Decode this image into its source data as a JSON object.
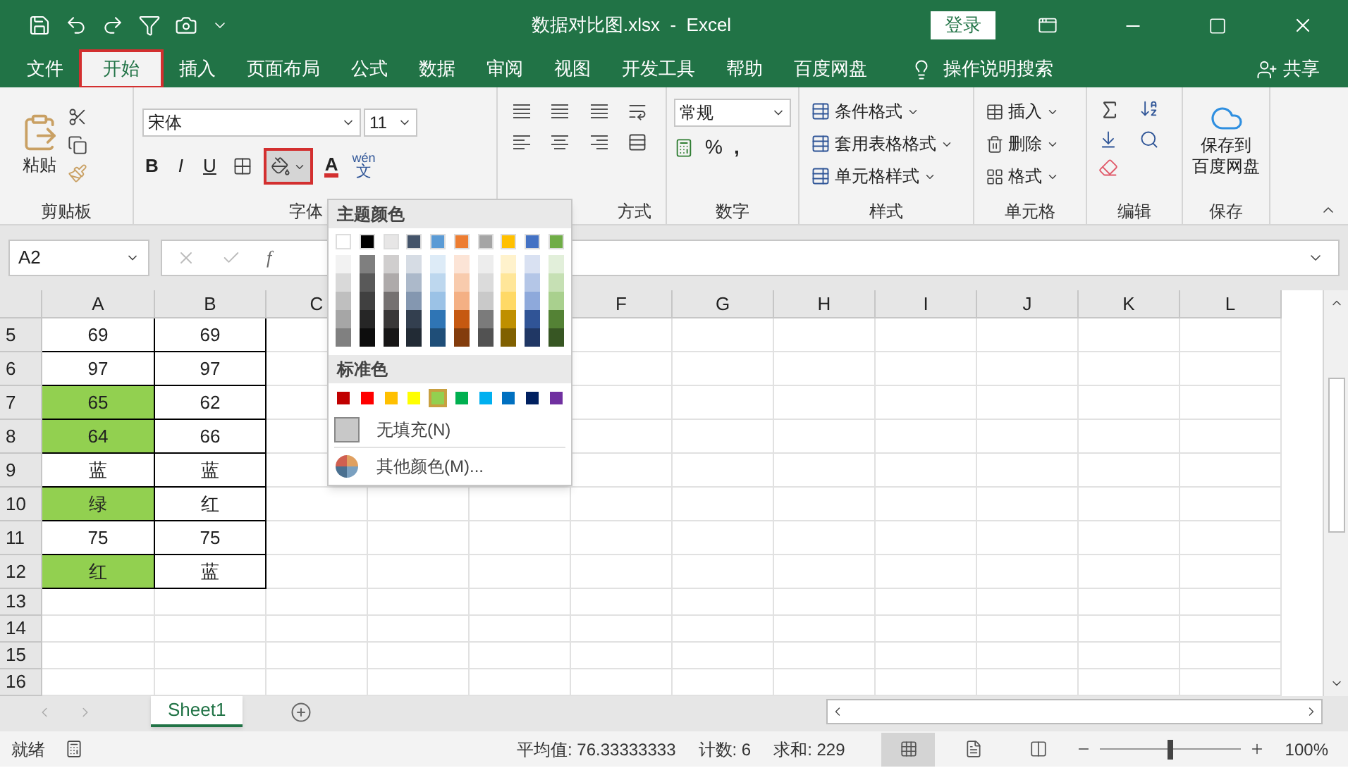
{
  "window": {
    "title": "数据对比图.xlsx  -  Excel",
    "login_button": "登录"
  },
  "menu_tabs": [
    {
      "label": "文件",
      "selected": false,
      "annotated": false
    },
    {
      "label": "开始",
      "selected": true,
      "annotated": true
    },
    {
      "label": "插入",
      "selected": false,
      "annotated": false
    },
    {
      "label": "页面布局",
      "selected": false,
      "annotated": false
    },
    {
      "label": "公式",
      "selected": false,
      "annotated": false
    },
    {
      "label": "数据",
      "selected": false,
      "annotated": false
    },
    {
      "label": "审阅",
      "selected": false,
      "annotated": false
    },
    {
      "label": "视图",
      "selected": false,
      "annotated": false
    },
    {
      "label": "开发工具",
      "selected": false,
      "annotated": false
    },
    {
      "label": "帮助",
      "selected": false,
      "annotated": false
    },
    {
      "label": "百度网盘",
      "selected": false,
      "annotated": false
    }
  ],
  "search_hint": "操作说明搜索",
  "share_button": "共享",
  "ribbon": {
    "clipboard": {
      "paste": "粘贴",
      "group": "剪贴板"
    },
    "font": {
      "name": "宋体",
      "size": "11",
      "bold": "B",
      "italic": "I",
      "underline": "U",
      "font_color": "A",
      "phonetic_top": "wén",
      "phonetic_bottom": "文",
      "group": "字体",
      "fill_button_annotated": true
    },
    "alignment": {
      "group": "方式"
    },
    "number": {
      "format": "常规",
      "percent": "%",
      "comma": ",",
      "group": "数字"
    },
    "styles": {
      "items": [
        "条件格式",
        "套用表格格式",
        "单元格样式"
      ],
      "group": "样式"
    },
    "cells": {
      "items": [
        "插入",
        "删除",
        "格式"
      ],
      "group": "单元格"
    },
    "editing": {
      "group": "编辑"
    },
    "save": {
      "line1": "保存到",
      "line2": "百度网盘",
      "group": "保存"
    }
  },
  "formula_bar": {
    "name_box": "A2",
    "fx": "f"
  },
  "columns": [
    {
      "label": "A"
    },
    {
      "label": "B"
    },
    {
      "label": "C"
    },
    {},
    {},
    {
      "label": "F"
    },
    {
      "label": "G"
    },
    {
      "label": "H"
    },
    {
      "label": "I"
    },
    {
      "label": "J"
    },
    {
      "label": "K"
    },
    {
      "label": "L"
    }
  ],
  "rows": [
    {
      "num": "5",
      "a": "69",
      "b": "69",
      "a_highlighted": false
    },
    {
      "num": "6",
      "a": "97",
      "b": "97",
      "a_highlighted": false
    },
    {
      "num": "7",
      "a": "65",
      "b": "62",
      "a_highlighted": true
    },
    {
      "num": "8",
      "a": "64",
      "b": "66",
      "a_highlighted": true
    },
    {
      "num": "9",
      "a": "蓝",
      "b": "蓝",
      "a_highlighted": false
    },
    {
      "num": "10",
      "a": "绿",
      "b": "红",
      "a_highlighted": true
    },
    {
      "num": "11",
      "a": "75",
      "b": "75",
      "a_highlighted": false
    },
    {
      "num": "12",
      "a": "红",
      "b": "蓝",
      "a_highlighted": true
    },
    {
      "num": "13"
    },
    {
      "num": "14"
    },
    {
      "num": "15"
    },
    {
      "num": "16"
    }
  ],
  "fill_menu": {
    "theme_title": "主题颜色",
    "theme_colors": [
      {
        "color": "#ffffff",
        "shades": [
          {
            "color": "#f2f2f2"
          },
          {
            "color": "#d9d9d9"
          },
          {
            "color": "#bfbfbf"
          },
          {
            "color": "#a6a6a6"
          },
          {
            "color": "#808080"
          }
        ]
      },
      {
        "color": "#000000",
        "shades": [
          {
            "color": "#7f7f7f"
          },
          {
            "color": "#595959"
          },
          {
            "color": "#404040"
          },
          {
            "color": "#262626"
          },
          {
            "color": "#0d0d0d"
          }
        ]
      },
      {
        "color": "#e7e6e6",
        "shades": [
          {
            "color": "#d0cece"
          },
          {
            "color": "#aeaaaa"
          },
          {
            "color": "#757171"
          },
          {
            "color": "#3a3838"
          },
          {
            "color": "#171616"
          }
        ]
      },
      {
        "color": "#44546a",
        "shades": [
          {
            "color": "#d6dce4"
          },
          {
            "color": "#acb9ca"
          },
          {
            "color": "#8497b0"
          },
          {
            "color": "#333f4f"
          },
          {
            "color": "#222b35"
          }
        ]
      },
      {
        "color": "#5b9bd5",
        "shades": [
          {
            "color": "#ddebf7"
          },
          {
            "color": "#bdd7ee"
          },
          {
            "color": "#9bc2e6"
          },
          {
            "color": "#2f75b5"
          },
          {
            "color": "#1f4e78"
          }
        ]
      },
      {
        "color": "#ed7d31",
        "shades": [
          {
            "color": "#fce4d6"
          },
          {
            "color": "#f8cbad"
          },
          {
            "color": "#f4b084"
          },
          {
            "color": "#c65911"
          },
          {
            "color": "#833c0c"
          }
        ]
      },
      {
        "color": "#a5a5a5",
        "shades": [
          {
            "color": "#ededed"
          },
          {
            "color": "#dbdbdb"
          },
          {
            "color": "#c9c9c9"
          },
          {
            "color": "#7b7b7b"
          },
          {
            "color": "#525252"
          }
        ]
      },
      {
        "color": "#ffc000",
        "shades": [
          {
            "color": "#fff2cc"
          },
          {
            "color": "#ffe699"
          },
          {
            "color": "#ffd966"
          },
          {
            "color": "#bf8f00"
          },
          {
            "color": "#806000"
          }
        ]
      },
      {
        "color": "#4472c4",
        "shades": [
          {
            "color": "#d9e1f2"
          },
          {
            "color": "#b4c6e7"
          },
          {
            "color": "#8ea9db"
          },
          {
            "color": "#305496"
          },
          {
            "color": "#203764"
          }
        ]
      },
      {
        "color": "#70ad47",
        "shades": [
          {
            "color": "#e2efda"
          },
          {
            "color": "#c6e0b4"
          },
          {
            "color": "#a9d08e"
          },
          {
            "color": "#548235"
          },
          {
            "color": "#375623"
          }
        ]
      }
    ],
    "standard_title": "标准色",
    "standard_colors": [
      {
        "color": "#c00000",
        "selected": false
      },
      {
        "color": "#ff0000",
        "selected": false
      },
      {
        "color": "#ffc000",
        "selected": false
      },
      {
        "color": "#ffff00",
        "selected": false
      },
      {
        "color": "#92d050",
        "selected": true
      },
      {
        "color": "#00b050",
        "selected": false
      },
      {
        "color": "#00b0f0",
        "selected": false
      },
      {
        "color": "#0070c0",
        "selected": false
      },
      {
        "color": "#002060",
        "selected": false
      },
      {
        "color": "#7030a0",
        "selected": false
      }
    ],
    "no_fill": "无填充(N)",
    "more_colors": "其他颜色(M)..."
  },
  "sheet_tabs": [
    {
      "label": "Sheet1",
      "selected": true
    }
  ],
  "status_bar": {
    "state": "就绪",
    "average": "平均值: 76.33333333",
    "count": "计数: 6",
    "sum": "求和: 229",
    "zoom": "100%",
    "level": 0.5,
    "views": [
      {
        "kind": "normal",
        "selected": true
      },
      {
        "kind": "layout",
        "selected": false
      },
      {
        "kind": "pagebreak",
        "selected": false
      }
    ]
  }
}
